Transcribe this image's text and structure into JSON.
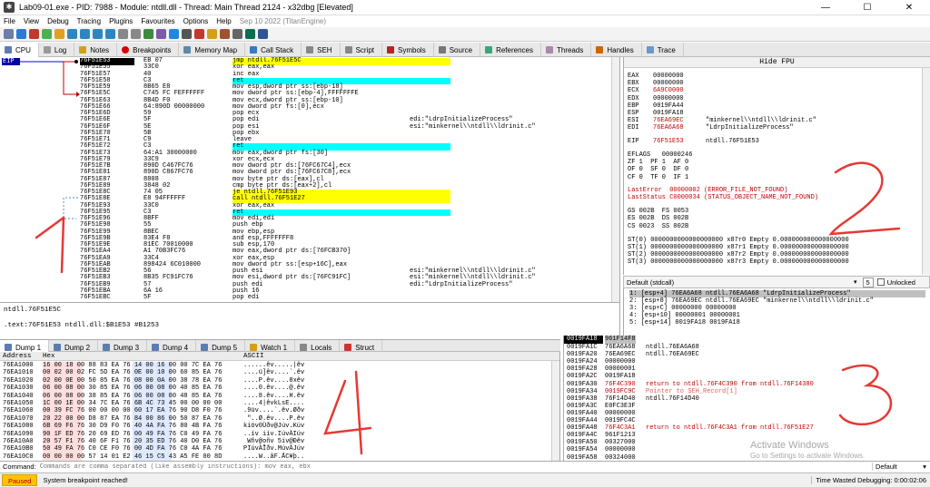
{
  "window": {
    "title": "Lab09-01.exe - PID: 7988 - Module: ntdll.dll - Thread: Main Thread 2124 - x32dbg [Elevated]",
    "minimize": "—",
    "maximize": "☐",
    "close": "✕"
  },
  "menu": [
    "File",
    "View",
    "Debug",
    "Tracing",
    "Plugins",
    "Favourites",
    "Options",
    "Help"
  ],
  "menu_date": "Sep 10 2022 (TitanEngine)",
  "tabs": [
    "CPU",
    "Log",
    "Notes",
    "Breakpoints",
    "Memory Map",
    "Call Stack",
    "SEH",
    "Script",
    "Symbols",
    "Source",
    "References",
    "Threads",
    "Handles",
    "Trace"
  ],
  "disasm": {
    "eip_label": "EIP",
    "rows": [
      {
        "addr": "76F51E53",
        "bytes": "EB 07",
        "ins": "jmp ntdll.76F51E5C",
        "cm": ""
      },
      {
        "addr": "76F51E55",
        "bytes": "33C0",
        "ins": "xor eax,eax",
        "cm": ""
      },
      {
        "addr": "76F51E57",
        "bytes": "40",
        "ins": "inc eax",
        "cm": ""
      },
      {
        "addr": "76F51E58",
        "bytes": "C3",
        "ins": "ret",
        "cm": ""
      },
      {
        "addr": "76F51E59",
        "bytes": "8B65 E8",
        "ins": "mov esp,dword ptr ss:[ebp-18]",
        "cm": ""
      },
      {
        "addr": "76F51E5C",
        "bytes": "C745 FC FEFFFFFF",
        "ins": "mov dword ptr ss:[ebp-4],FFFFFFFE",
        "cm": ""
      },
      {
        "addr": "76F51E63",
        "bytes": "8B4D F0",
        "ins": "mov ecx,dword ptr ss:[ebp-10]",
        "cm": ""
      },
      {
        "addr": "76F51E66",
        "bytes": "64:890D 00000000",
        "ins": "mov dword ptr fs:[0],ecx",
        "cm": ""
      },
      {
        "addr": "76F51E6D",
        "bytes": "59",
        "ins": "pop ecx",
        "cm": ""
      },
      {
        "addr": "76F51E6E",
        "bytes": "5F",
        "ins": "pop edi",
        "cm": "edi:\"LdrpInitializeProcess\""
      },
      {
        "addr": "76F51E6F",
        "bytes": "5E",
        "ins": "pop esi",
        "cm": "esi:\"minkernel\\\\ntdll\\\\ldrinit.c\""
      },
      {
        "addr": "76F51E70",
        "bytes": "5B",
        "ins": "pop ebx",
        "cm": ""
      },
      {
        "addr": "76F51E71",
        "bytes": "C9",
        "ins": "leave",
        "cm": ""
      },
      {
        "addr": "76F51E72",
        "bytes": "C3",
        "ins": "ret",
        "cm": ""
      },
      {
        "addr": "76F51E73",
        "bytes": "64:A1 30000000",
        "ins": "mov eax,dword ptr fs:[30]",
        "cm": ""
      },
      {
        "addr": "76F51E79",
        "bytes": "33C9",
        "ins": "xor ecx,ecx",
        "cm": ""
      },
      {
        "addr": "76F51E7B",
        "bytes": "890D C467FC76",
        "ins": "mov dword ptr ds:[76FC67C4],ecx",
        "cm": ""
      },
      {
        "addr": "76F51E81",
        "bytes": "890D C867FC76",
        "ins": "mov dword ptr ds:[76FC67C8],ecx",
        "cm": ""
      },
      {
        "addr": "76F51E87",
        "bytes": "8808",
        "ins": "mov byte ptr ds:[eax],cl",
        "cm": ""
      },
      {
        "addr": "76F51E89",
        "bytes": "3848 02",
        "ins": "cmp byte ptr ds:[eax+2],cl",
        "cm": ""
      },
      {
        "addr": "76F51E8C",
        "bytes": "74 05",
        "ins": "je ntdll.76F51E93",
        "cm": ""
      },
      {
        "addr": "76F51E8E",
        "bytes": "E8 94FFFFFF",
        "ins": "call ntdll.76F51E27",
        "cm": ""
      },
      {
        "addr": "76F51E93",
        "bytes": "33C0",
        "ins": "xor eax,eax",
        "cm": ""
      },
      {
        "addr": "76F51E95",
        "bytes": "C3",
        "ins": "ret",
        "cm": ""
      },
      {
        "addr": "76F51E96",
        "bytes": "8BFF",
        "ins": "mov edi,edi",
        "cm": ""
      },
      {
        "addr": "76F51E98",
        "bytes": "55",
        "ins": "push ebp",
        "cm": ""
      },
      {
        "addr": "76F51E99",
        "bytes": "8BEC",
        "ins": "mov ebp,esp",
        "cm": ""
      },
      {
        "addr": "76F51E9B",
        "bytes": "83E4 F8",
        "ins": "and esp,FFFFFFF8",
        "cm": ""
      },
      {
        "addr": "76F51E9E",
        "bytes": "81EC 70010000",
        "ins": "sub esp,170",
        "cm": ""
      },
      {
        "addr": "76F51EA4",
        "bytes": "A1 70B3FC76",
        "ins": "mov eax,dword ptr ds:[76FCB370]",
        "cm": ""
      },
      {
        "addr": "76F51EA9",
        "bytes": "33C4",
        "ins": "xor eax,esp",
        "cm": ""
      },
      {
        "addr": "76F51EAB",
        "bytes": "898424 6C010000",
        "ins": "mov dword ptr ss:[esp+16C],eax",
        "cm": ""
      },
      {
        "addr": "76F51EB2",
        "bytes": "56",
        "ins": "push esi",
        "cm": "esi:\"minkernel\\\\ntdll\\\\ldrinit.c\""
      },
      {
        "addr": "76F51EB3",
        "bytes": "8B35 FC91FC76",
        "ins": "mov esi,dword ptr ds:[76FC91FC]",
        "cm": "esi:\"minkernel\\\\ntdll\\\\ldrinit.c\""
      },
      {
        "addr": "76F51EB9",
        "bytes": "57",
        "ins": "push edi",
        "cm": "edi:\"LdrpInitializeProcess\""
      },
      {
        "addr": "76F51EBA",
        "bytes": "6A 16",
        "ins": "push 16",
        "cm": ""
      },
      {
        "addr": "76F51EBC",
        "bytes": "5F",
        "ins": "pop edi",
        "cm": ""
      }
    ]
  },
  "info": {
    "line1": "ntdll.76F51E5C",
    "line2": ".text:76F51E53 ntdll.dll:$B1E53 #B1253"
  },
  "registers": {
    "hide_fpu": "Hide FPU",
    "gp": [
      {
        "name": "EAX",
        "val": "00000000",
        "cm": ""
      },
      {
        "name": "EBX",
        "val": "00000000",
        "cm": ""
      },
      {
        "name": "ECX",
        "val": "6A9C0000",
        "cm": ""
      },
      {
        "name": "EDX",
        "val": "00000000",
        "cm": ""
      },
      {
        "name": "EBP",
        "val": "0019FA44",
        "cm": ""
      },
      {
        "name": "ESP",
        "val": "0019FA18",
        "cm": ""
      },
      {
        "name": "ESI",
        "val": "76EA69EC",
        "cm": "\"minkernel\\\\ntdll\\\\ldrinit.c\""
      },
      {
        "name": "EDI",
        "val": "76EA6A68",
        "cm": "\"LdrpInitializeProcess\""
      }
    ],
    "eip": {
      "name": "EIP",
      "val": "76F51E53",
      "cm": "ntdll.76F51E53"
    },
    "eflags": "EFLAGS   00000246",
    "flags": [
      "ZF 1  PF 1  AF 0",
      "OF 0  SF 0  DF 0",
      "CF 0  TF 0  IF 1"
    ],
    "lasterror": "LastError  00000002 (ERROR_FILE_NOT_FOUND)",
    "laststatus": "LastStatus C0000034 (STATUS_OBJECT_NAME_NOT_FOUND)",
    "segs": [
      "GS 002B  FS 0053",
      "ES 002B  DS 002B",
      "CS 0023  SS 002B"
    ],
    "st": [
      "ST(0) 0000000000000000000 x87r0 Empty 0.000000000000000000",
      "ST(1) 0000000000000000000 x87r1 Empty 0.000000000000000000",
      "ST(2) 0000000000000000000 x87r2 Empty 0.000000000000000000",
      "ST(3) 0000000000000000000 x87r3 Empty 0.000000000000000000"
    ]
  },
  "callconv": {
    "label": "Default (stdcall)",
    "count": "5",
    "unlocked": "Unlocked"
  },
  "args": [
    "1: [esp+4] 76EA6A68 ntdll.76EA6A68 \"LdrpInitializeProcess\"",
    "2: [esp+8] 76EA69EC ntdll.76EA69EC \"minkernel\\\\ntdll\\\\ldrinit.c\"",
    "3: [esp+C] 00000000 00000000",
    "4: [esp+10] 00000001 00000001",
    "5: [esp+14] 0019FA18 0019FA18"
  ],
  "dump_tabs": [
    "Dump 1",
    "Dump 2",
    "Dump 3",
    "Dump 4",
    "Dump 5",
    "Watch 1",
    "Locals",
    "Struct"
  ],
  "dump": {
    "col_address": "Address",
    "col_hex": "Hex",
    "col_ascii": "ASCII",
    "rows": [
      {
        "a": "76EA1000",
        "h": "16 00 18 00 88 83 EA 76 14 00 16 00 00 7C EA 76",
        "s": "......êv.....|êv"
      },
      {
        "a": "76EA1010",
        "h": "00 02 00 02 FC 5D EA 76 0E 00 10 00 60 85 EA 76",
        "s": "....ü]êv....`.êv"
      },
      {
        "a": "76EA1020",
        "h": "02 00 0E 00 50 85 EA 76 08 00 0A 00 38 78 EA 76",
        "s": "....P.êv....8xêv"
      },
      {
        "a": "76EA1030",
        "h": "06 00 08 00 30 85 EA 76 06 00 08 00 40 85 EA 76",
        "s": "....0.êv....@.êv"
      },
      {
        "a": "76EA1040",
        "h": "06 00 08 00 38 85 EA 76 06 00 08 00 48 85 EA 76",
        "s": "....8.êv....H.êv"
      },
      {
        "a": "76EA1050",
        "h": "1C 00 1E 00 34 7C EA 76 6B 4C 73 45 00 00 00 00",
        "s": "....4|êvkLsE...."
      },
      {
        "a": "76EA1060",
        "h": "00 39 FC 76 00 00 00 00 60 17 EA 76 90 D8 F0 76",
        "s": ".9üv....`.êv.Øðv"
      },
      {
        "a": "76EA1070",
        "h": "20 22 00 00 D8 87 EA 76 84 00 86 00 50 87 EA 76",
        "s": " \"..Ø.êv....P.êv"
      },
      {
        "a": "76EA1080",
        "h": "6B 69 F6 76 30 D9 F0 76 40 4A FA 76 80 4B FA 76",
        "s": "kiöv0Ùðv@Júv.Kúv"
      },
      {
        "a": "76EA1090",
        "h": "90 1F ED 76 20 69 ED 76 00 49 FA 76 C0 49 FA 76",
        "s": "..ív iív.IúvÀIúv"
      },
      {
        "a": "76EA10A0",
        "h": "20 57 F1 76 40 6F F1 76 20 35 ED 76 40 D0 EA 76",
        "s": " Wñv@oñv 5ív@Ðêv"
      },
      {
        "a": "76EA10B0",
        "h": "50 49 FA 76 C0 CE F0 76 00 4D FA 76 C0 4A FA 76",
        "s": "PIúvÀÎðv.MúvÀJúv"
      },
      {
        "a": "76EA10C0",
        "h": "00 00 00 00 57 14 01 E2 46 15 C5 43 A5 FE 00 8D",
        "s": "....W..âF.ÅC¥þ.."
      }
    ]
  },
  "stack": {
    "esp_tag": "0019FA18",
    "esp_val": "961F14F8",
    "rows": [
      {
        "a": "0019FA1C",
        "v": "76EA6A68",
        "c": "ntdll.76EA6A68",
        "red": false
      },
      {
        "a": "0019FA20",
        "v": "76EA69EC",
        "c": "ntdll.76EA69EC",
        "red": false
      },
      {
        "a": "0019FA24",
        "v": "00000000",
        "c": "",
        "red": false
      },
      {
        "a": "0019FA28",
        "v": "00000001",
        "c": "",
        "red": false
      },
      {
        "a": "0019FA2C",
        "v": "0019FA18",
        "c": "",
        "red": false
      },
      {
        "a": "0019FA30",
        "v": "76F4C390",
        "c": "return to ntdll.76F4C390 from ntdll.76F14380",
        "red": true
      },
      {
        "a": "0019FA34",
        "v": "0019FC9C",
        "c": "Pointer to SEH_Record[1]",
        "red": true
      },
      {
        "a": "0019FA38",
        "v": "76F14D40",
        "c": "ntdll.76F14D40",
        "red": false
      },
      {
        "a": "0019FA3C",
        "v": "E0FC3E3F",
        "c": "",
        "red": false
      },
      {
        "a": "0019FA40",
        "v": "00000000",
        "c": "",
        "red": false
      },
      {
        "a": "0019FA44",
        "v": "0019FC4C",
        "c": "",
        "red": false
      },
      {
        "a": "0019FA48",
        "v": "76F4C3A1",
        "c": "return to ntdll.76F4C3A1 from ntdll.76F51E27",
        "red": true
      },
      {
        "a": "0019FA4C",
        "v": "961F1213",
        "c": "",
        "red": false
      },
      {
        "a": "0019FA50",
        "v": "00327000",
        "c": "",
        "red": false
      },
      {
        "a": "0019FA54",
        "v": "00000000",
        "c": "",
        "red": false
      },
      {
        "a": "0019FA58",
        "v": "00324000",
        "c": "",
        "red": false
      }
    ]
  },
  "command": {
    "label": "Command:",
    "placeholder": "Commands are comma separated (like assembly instructions): mov eax, ebx",
    "mode": "Default"
  },
  "status": {
    "state": "Paused",
    "message": "System breakpoint reached!",
    "time": "Time Wasted Debugging: 0:00:02:06"
  },
  "watermark": {
    "line1": "Activate Windows",
    "line2": "Go to Settings to activate Windows."
  },
  "annotations": [
    "1",
    "2",
    "3",
    "4"
  ]
}
